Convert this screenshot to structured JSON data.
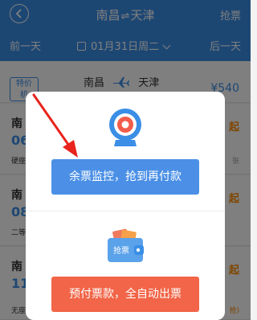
{
  "header": {
    "from": "南昌",
    "to": "天津",
    "grab_label": "抢票"
  },
  "datebar": {
    "prev_label": "前一天",
    "date_label": "01月31日周二",
    "next_label": "后一天"
  },
  "promo": {
    "badge_line1": "特价",
    "badge_line2": "机",
    "from": "南昌",
    "to": "天津",
    "price": "¥540"
  },
  "trains": [
    {
      "code": "南",
      "time": "06",
      "seat": "硬座",
      "price": "起",
      "remain": "张"
    },
    {
      "code": "南",
      "time": "08",
      "seat": "二等",
      "price": "起",
      "remain": ""
    },
    {
      "code": "南",
      "time": "11",
      "seat": "无座",
      "price": "起",
      "remain": "抢)"
    }
  ],
  "dialog": {
    "monitor_label": "余票监控，抢到再付款",
    "wallet_icon_text": "抢票",
    "prepay_label": "预付票款，全自动出票"
  },
  "colors": {
    "primary": "#3a8ee6",
    "monitor_button": "#4b90e6",
    "prepay_button": "#f26548",
    "price_orange": "#ff8a00",
    "arrow_red": "#e8241d"
  }
}
